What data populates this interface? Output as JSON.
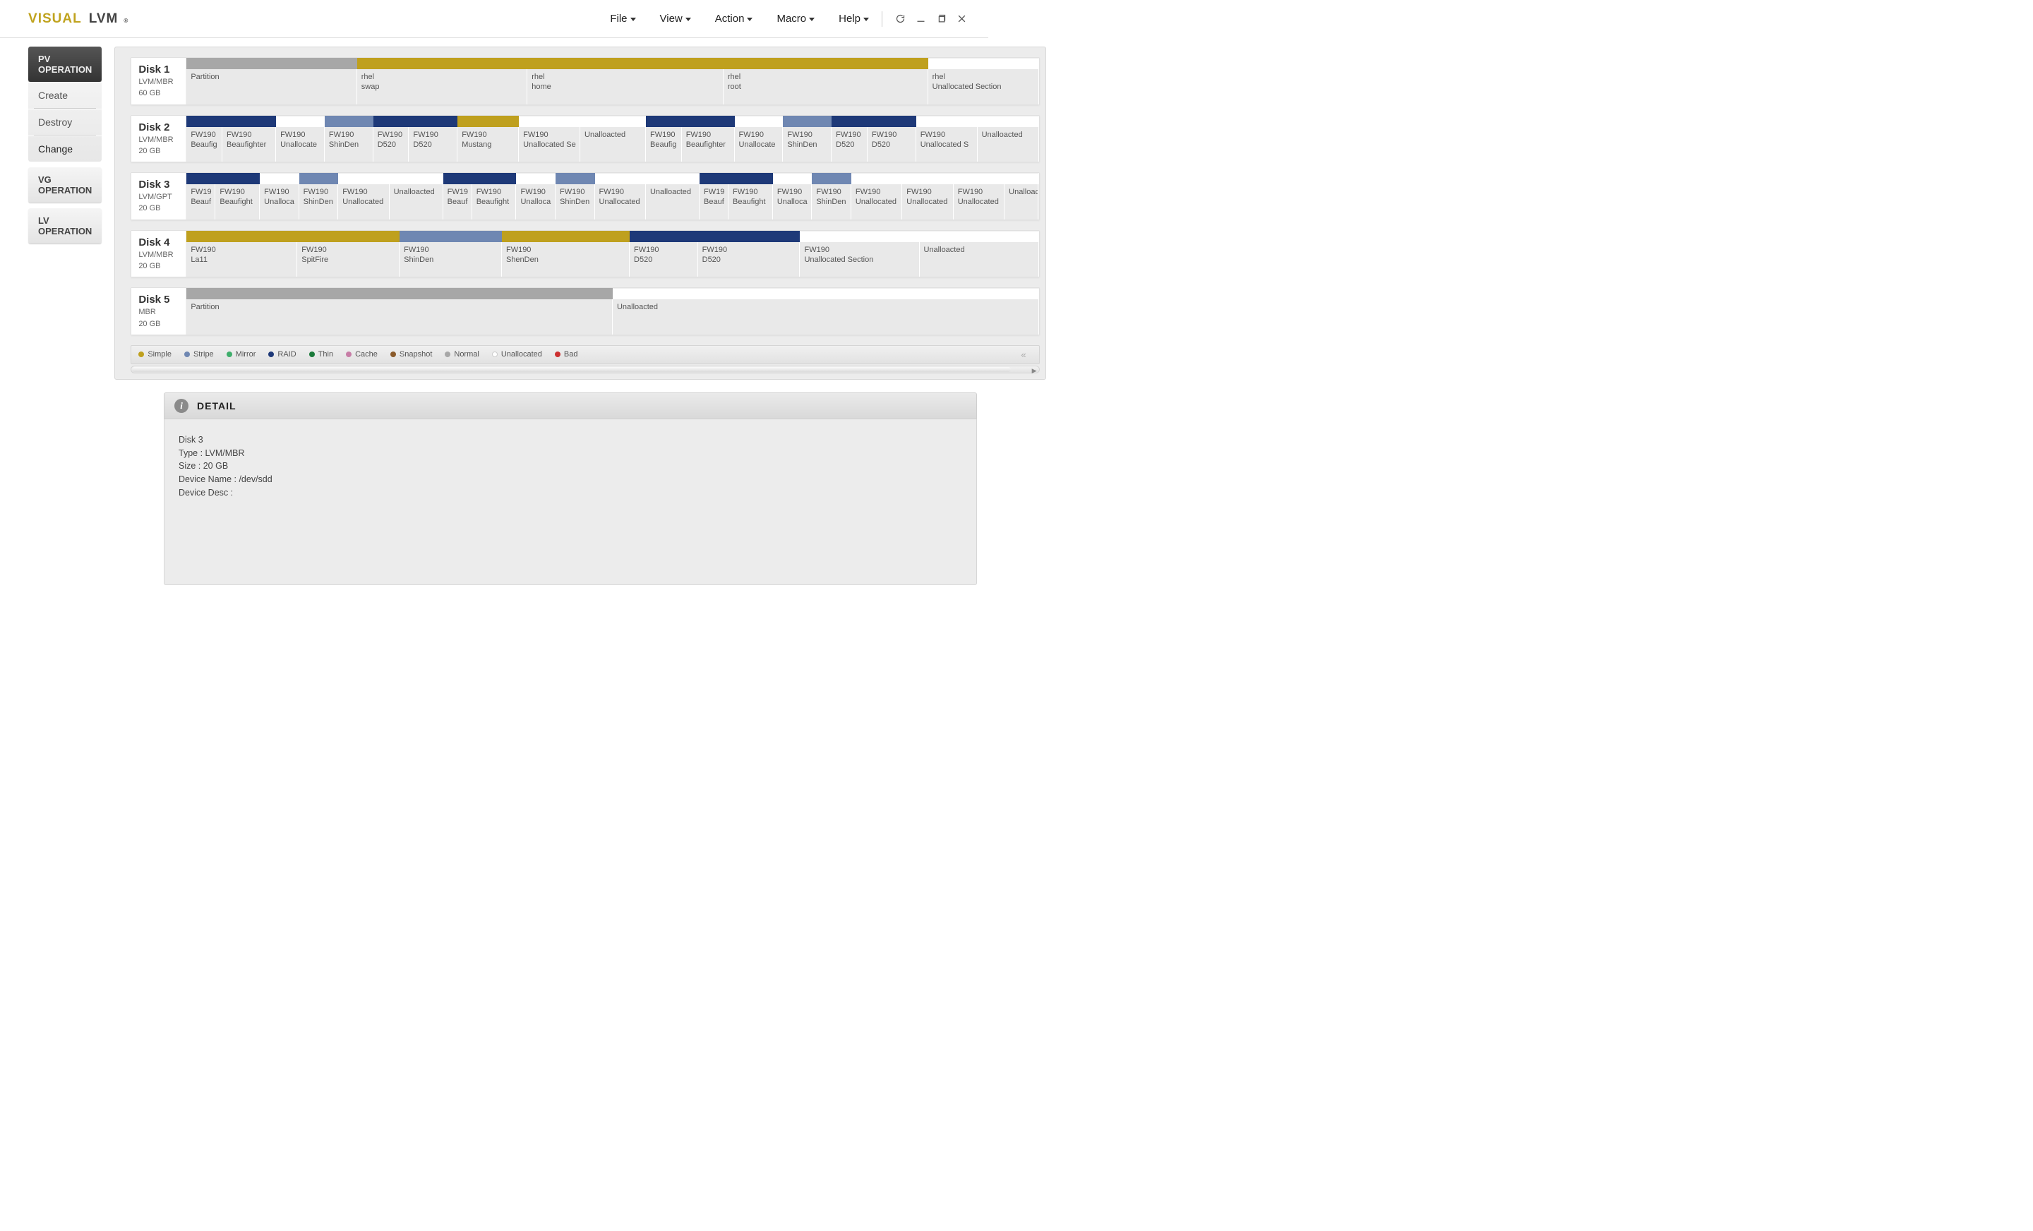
{
  "app": {
    "logo_v": "V",
    "logo_isual": "ISUAL",
    "logo_lvm": "LVM",
    "logo_reg": "®"
  },
  "menu": {
    "file": "File",
    "view": "View",
    "action": "Action",
    "macro": "Macro",
    "help": "Help"
  },
  "sidebar": {
    "pv": {
      "title": "PV OPERATION",
      "create": "Create",
      "destroy": "Destroy",
      "change": "Change"
    },
    "vg": {
      "title": "VG OPERATION"
    },
    "lv": {
      "title": "LV OPERATION"
    }
  },
  "colors": {
    "gray": "#a7a7a7",
    "mustard": "#bfa01e",
    "white": "#ffffff",
    "navy": "#1e3978",
    "slate": "#6f87b2"
  },
  "disks": [
    {
      "name": "Disk 1",
      "sub1": "LVM/MBR",
      "sub2": "60 GB",
      "segments": [
        {
          "color": "gray",
          "width": 20,
          "label1": "Partition",
          "label2": ""
        },
        {
          "color": "mustard",
          "width": 20,
          "label1": "rhel",
          "label2": "swap"
        },
        {
          "color": "mustard",
          "width": 23,
          "label1": "rhel",
          "label2": "home"
        },
        {
          "color": "mustard",
          "width": 24,
          "label1": "rhel",
          "label2": "root"
        },
        {
          "color": "white",
          "width": 13,
          "label1": "rhel",
          "label2": "Unallocated Section"
        }
      ]
    },
    {
      "name": "Disk 2",
      "sub1": "LVM/MBR",
      "sub2": "20 GB",
      "segments": [
        {
          "color": "navy",
          "width": 4.2,
          "label1": "FW190",
          "label2": "Beaufig"
        },
        {
          "color": "navy",
          "width": 6.3,
          "label1": "FW190",
          "label2": "Beaufighter"
        },
        {
          "color": "white",
          "width": 5.7,
          "label1": "FW190",
          "label2": "Unallocate"
        },
        {
          "color": "slate",
          "width": 5.7,
          "label1": "FW190",
          "label2": "ShinDen"
        },
        {
          "color": "navy",
          "width": 4.2,
          "label1": "FW190",
          "label2": "D520"
        },
        {
          "color": "navy",
          "width": 5.7,
          "label1": "FW190",
          "label2": "D520"
        },
        {
          "color": "mustard",
          "width": 7.2,
          "label1": "FW190",
          "label2": "Mustang"
        },
        {
          "color": "white",
          "width": 7.2,
          "label1": "FW190",
          "label2": "Unallocated Se"
        },
        {
          "color": "white",
          "width": 7.7,
          "label1": "Unalloacted",
          "label2": ""
        },
        {
          "color": "navy",
          "width": 4.2,
          "label1": "FW190",
          "label2": "Beaufig"
        },
        {
          "color": "navy",
          "width": 6.2,
          "label1": "FW190",
          "label2": "Beaufighter"
        },
        {
          "color": "white",
          "width": 5.7,
          "label1": "FW190",
          "label2": "Unallocate"
        },
        {
          "color": "slate",
          "width": 5.7,
          "label1": "FW190",
          "label2": "ShinDen"
        },
        {
          "color": "navy",
          "width": 4.2,
          "label1": "FW190",
          "label2": "D520"
        },
        {
          "color": "navy",
          "width": 5.7,
          "label1": "FW190",
          "label2": "D520"
        },
        {
          "color": "white",
          "width": 7.2,
          "label1": "FW190",
          "label2": "Unallocated S"
        },
        {
          "color": "white",
          "width": 7.2,
          "label1": "Unalloacted",
          "label2": ""
        }
      ]
    },
    {
      "name": "Disk 3",
      "sub1": "LVM/GPT",
      "sub2": "20 GB",
      "segments": [
        {
          "color": "navy",
          "width": 3.4,
          "label1": "FW19",
          "label2": "Beauf"
        },
        {
          "color": "navy",
          "width": 5.2,
          "label1": "FW190",
          "label2": "Beaufight"
        },
        {
          "color": "white",
          "width": 4.6,
          "label1": "FW190",
          "label2": "Unalloca"
        },
        {
          "color": "slate",
          "width": 4.6,
          "label1": "FW190",
          "label2": "ShinDen"
        },
        {
          "color": "white",
          "width": 6.0,
          "label1": "FW190",
          "label2": "Unallocated"
        },
        {
          "color": "white",
          "width": 6.3,
          "label1": "Unalloacted",
          "label2": ""
        },
        {
          "color": "navy",
          "width": 3.4,
          "label1": "FW19",
          "label2": "Beauf"
        },
        {
          "color": "navy",
          "width": 5.2,
          "label1": "FW190",
          "label2": "Beaufight"
        },
        {
          "color": "white",
          "width": 4.6,
          "label1": "FW190",
          "label2": "Unalloca"
        },
        {
          "color": "slate",
          "width": 4.6,
          "label1": "FW190",
          "label2": "ShinDen"
        },
        {
          "color": "white",
          "width": 6.0,
          "label1": "FW190",
          "label2": "Unallocated"
        },
        {
          "color": "white",
          "width": 6.3,
          "label1": "Unalloacted",
          "label2": ""
        },
        {
          "color": "navy",
          "width": 3.4,
          "label1": "FW19",
          "label2": "Beauf"
        },
        {
          "color": "navy",
          "width": 5.2,
          "label1": "FW190",
          "label2": "Beaufight"
        },
        {
          "color": "white",
          "width": 4.6,
          "label1": "FW190",
          "label2": "Unalloca"
        },
        {
          "color": "slate",
          "width": 4.6,
          "label1": "FW190",
          "label2": "ShinDen"
        },
        {
          "color": "white",
          "width": 6.0,
          "label1": "FW190",
          "label2": "Unallocated"
        },
        {
          "color": "white",
          "width": 6.0,
          "label1": "FW190",
          "label2": "Unallocated"
        },
        {
          "color": "white",
          "width": 6.0,
          "label1": "FW190",
          "label2": "Unallocated"
        },
        {
          "color": "white",
          "width": 4.0,
          "label1": "Unalloacted",
          "label2": ""
        }
      ]
    },
    {
      "name": "Disk 4",
      "sub1": "LVM/MBR",
      "sub2": "20 GB",
      "segments": [
        {
          "color": "mustard",
          "width": 13,
          "label1": "FW190",
          "label2": "La11"
        },
        {
          "color": "mustard",
          "width": 12,
          "label1": "FW190",
          "label2": "SpitFire"
        },
        {
          "color": "slate",
          "width": 12,
          "label1": "FW190",
          "label2": "ShinDen"
        },
        {
          "color": "mustard",
          "width": 15,
          "label1": "FW190",
          "label2": "ShenDen"
        },
        {
          "color": "navy",
          "width": 8,
          "label1": "FW190",
          "label2": "D520"
        },
        {
          "color": "navy",
          "width": 12,
          "label1": "FW190",
          "label2": "D520"
        },
        {
          "color": "white",
          "width": 14,
          "label1": "FW190",
          "label2": "Unallocated Section"
        },
        {
          "color": "white",
          "width": 14,
          "label1": "Unalloacted",
          "label2": ""
        }
      ]
    },
    {
      "name": "Disk 5",
      "sub1": "MBR",
      "sub2": "20 GB",
      "segments": [
        {
          "color": "gray",
          "width": 50,
          "label1": "Partition",
          "label2": ""
        },
        {
          "color": "white",
          "width": 50,
          "label1": "Unalloacted",
          "label2": ""
        }
      ]
    }
  ],
  "legend": {
    "simple": "Simple",
    "stripe": "Stripe",
    "mirror": "Mirror",
    "raid": "RAID",
    "thin": "Thin",
    "cache": "Cache",
    "snapshot": "Snapshot",
    "normal": "Normal",
    "unallocated": "Unallocated",
    "bad": "Bad"
  },
  "legend_colors": {
    "simple": "#bfa01e",
    "stripe": "#6f87b2",
    "mirror": "#3eae6b",
    "raid": "#1e3978",
    "thin": "#1a7a3a",
    "cache": "#c77da6",
    "snapshot": "#8a5a2a",
    "normal": "#a7a7a7",
    "unallocated": "#ffffff",
    "bad": "#cc3030"
  },
  "detail": {
    "title": "DETAIL",
    "line1": "Disk 3",
    "line2": "Type : LVM/MBR",
    "line3": "Size : 20 GB",
    "line4": "Device Name : /dev/sdd",
    "line5": "Device Desc :"
  }
}
